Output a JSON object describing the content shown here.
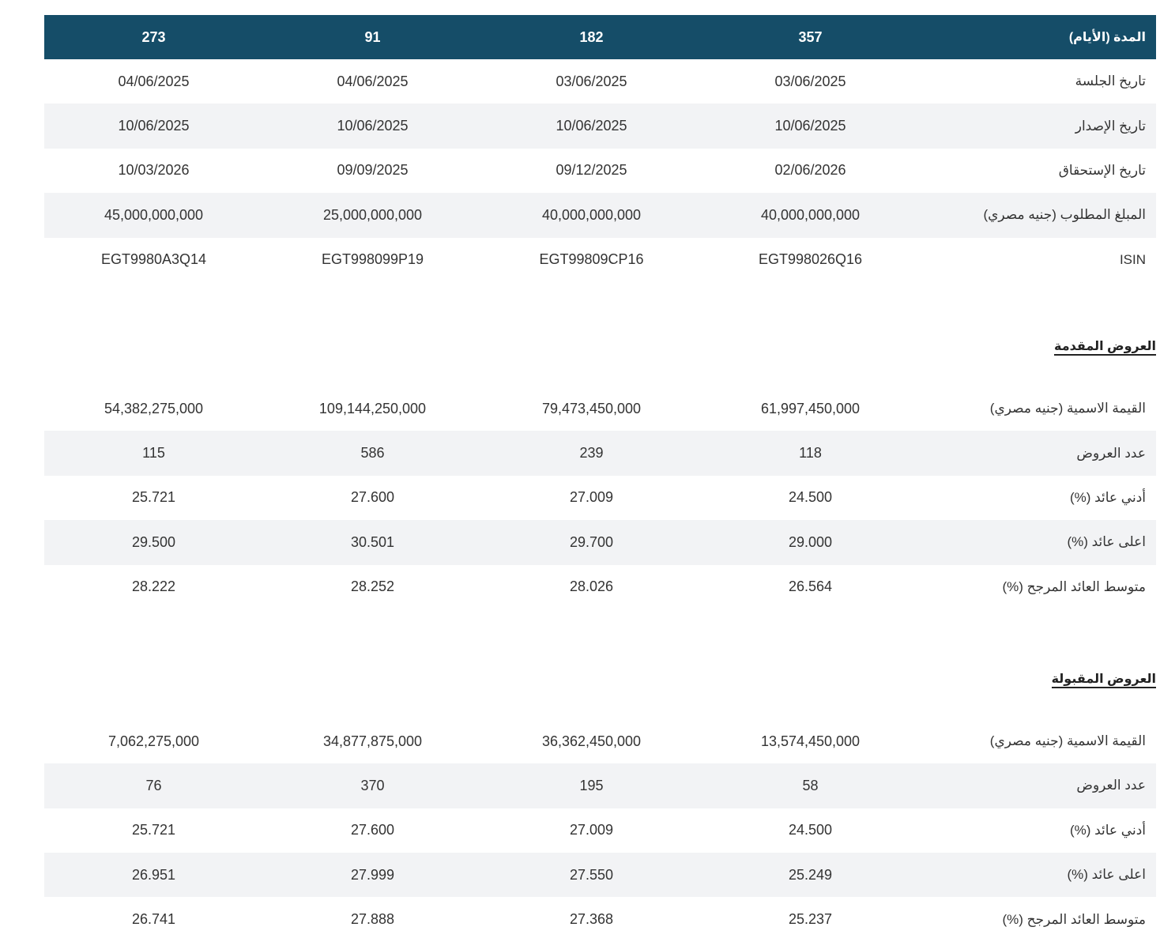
{
  "columns": [
    "357",
    "182",
    "91",
    "273"
  ],
  "header_label": "المدة (الأيام)",
  "info_rows": [
    {
      "label": "تاريخ الجلسة",
      "values": [
        "03/06/2025",
        "03/06/2025",
        "04/06/2025",
        "04/06/2025"
      ]
    },
    {
      "label": "تاريخ الإصدار",
      "values": [
        "10/06/2025",
        "10/06/2025",
        "10/06/2025",
        "10/06/2025"
      ]
    },
    {
      "label": "تاريخ الإستحقاق",
      "values": [
        "02/06/2026",
        "09/12/2025",
        "09/09/2025",
        "10/03/2026"
      ]
    },
    {
      "label": "المبلغ المطلوب (جنيه مصري)",
      "values": [
        "40,000,000,000",
        "40,000,000,000",
        "25,000,000,000",
        "45,000,000,000"
      ]
    },
    {
      "label": "ISIN",
      "values": [
        "EGT998026Q16",
        "EGT99809CP16",
        "EGT998099P19",
        "EGT9980A3Q14"
      ]
    }
  ],
  "offered": {
    "title": "العروض المقدمة",
    "rows": [
      {
        "label": "القيمة الاسمية (جنيه مصري)",
        "values": [
          "61,997,450,000",
          "79,473,450,000",
          "109,144,250,000",
          "54,382,275,000"
        ]
      },
      {
        "label": "عدد العروض",
        "values": [
          "118",
          "239",
          "586",
          "115"
        ]
      },
      {
        "label": "أدني عائد (%)",
        "values": [
          "24.500",
          "27.009",
          "27.600",
          "25.721"
        ]
      },
      {
        "label": "اعلى عائد (%)",
        "values": [
          "29.000",
          "29.700",
          "30.501",
          "29.500"
        ]
      },
      {
        "label": "متوسط العائد المرجح (%)",
        "values": [
          "26.564",
          "28.026",
          "28.252",
          "28.222"
        ]
      }
    ]
  },
  "accepted": {
    "title": "العروض المقبولة",
    "rows": [
      {
        "label": "القيمة الاسمية (جنيه مصري)",
        "values": [
          "13,574,450,000",
          "36,362,450,000",
          "34,877,875,000",
          "7,062,275,000"
        ]
      },
      {
        "label": "عدد العروض",
        "values": [
          "58",
          "195",
          "370",
          "76"
        ]
      },
      {
        "label": "أدني عائد (%)",
        "values": [
          "24.500",
          "27.009",
          "27.600",
          "25.721"
        ]
      },
      {
        "label": "اعلى عائد (%)",
        "values": [
          "25.249",
          "27.550",
          "27.999",
          "26.951"
        ]
      },
      {
        "label": "متوسط العائد المرجح (%)",
        "values": [
          "25.237",
          "27.368",
          "27.888",
          "26.741"
        ]
      }
    ]
  }
}
